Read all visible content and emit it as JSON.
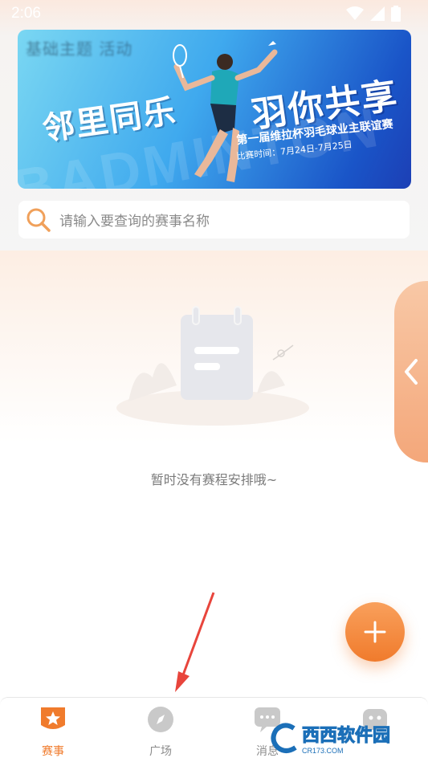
{
  "status_bar": {
    "time": "2:06"
  },
  "banner": {
    "blur_text": "基础主题 活动",
    "bg_word": "BADMINTON",
    "headline_left": "邻里同乐",
    "headline_right": "羽你共享",
    "subtitle": "第一届维拉杯羽毛球业主联谊赛",
    "date": "比赛时间：7月24日-7月25日"
  },
  "search": {
    "placeholder": "请输入要查询的赛事名称"
  },
  "empty_state": {
    "message": "暂时没有赛程安排哦~"
  },
  "fab": {
    "icon": "plus-icon"
  },
  "side_tab": {
    "icon": "chevron-left-icon"
  },
  "tabbar": {
    "items": [
      {
        "label": "赛事",
        "icon": "star-badge-icon",
        "active": true
      },
      {
        "label": "广场",
        "icon": "compass-icon",
        "active": false
      },
      {
        "label": "消息",
        "icon": "chat-icon",
        "active": false
      },
      {
        "label": "",
        "icon": "profile-icon",
        "active": false
      }
    ]
  },
  "watermark": {
    "text": "西西软件园",
    "domain": "CR173.COM"
  },
  "colors": {
    "accent": "#f07b2c",
    "inactive": "#9a9a9a",
    "banner_blue": "#1a55c8"
  }
}
